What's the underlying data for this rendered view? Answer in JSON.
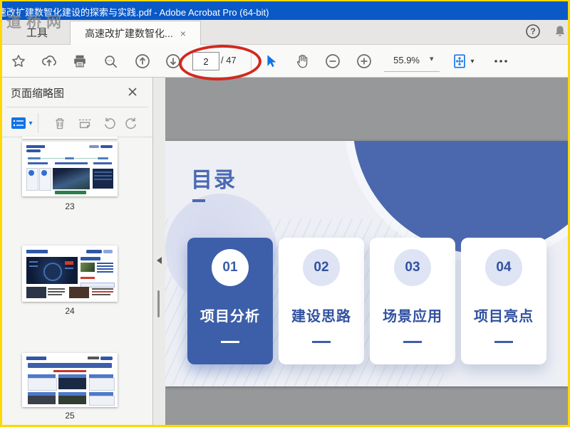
{
  "window": {
    "title": "速改扩建数智化建设的探索与实践.pdf - Adobe Acrobat Pro (64-bit)",
    "watermark": "道桥网"
  },
  "tab_bar": {
    "tools_tab": "工具",
    "document_tab": "高速改扩建数智化...",
    "close_label": "×"
  },
  "toolbar": {
    "page_current": "2",
    "page_total": "/ 47",
    "zoom_level": "55.9%"
  },
  "sidebar": {
    "title": "页面缩略图",
    "thumbnails": [
      {
        "page": "23"
      },
      {
        "page": "24"
      },
      {
        "page": "25"
      }
    ]
  },
  "document": {
    "page_title": "目录",
    "toc_cards": [
      {
        "number": "01",
        "label": "项目分析"
      },
      {
        "number": "02",
        "label": "建设思路"
      },
      {
        "number": "03",
        "label": "场景应用"
      },
      {
        "number": "04",
        "label": "项目亮点"
      }
    ]
  },
  "icons": {
    "help_glyph": "?"
  },
  "colors": {
    "titlebar_blue": "#0a59c6",
    "accent_blue": "#1373e6",
    "card_blue": "#3d5fa9",
    "hero_circle_blue": "#4b68ae",
    "page_bg": "#edeff5",
    "annotation_red": "#d3281e",
    "border_yellow": "#ffd800"
  }
}
